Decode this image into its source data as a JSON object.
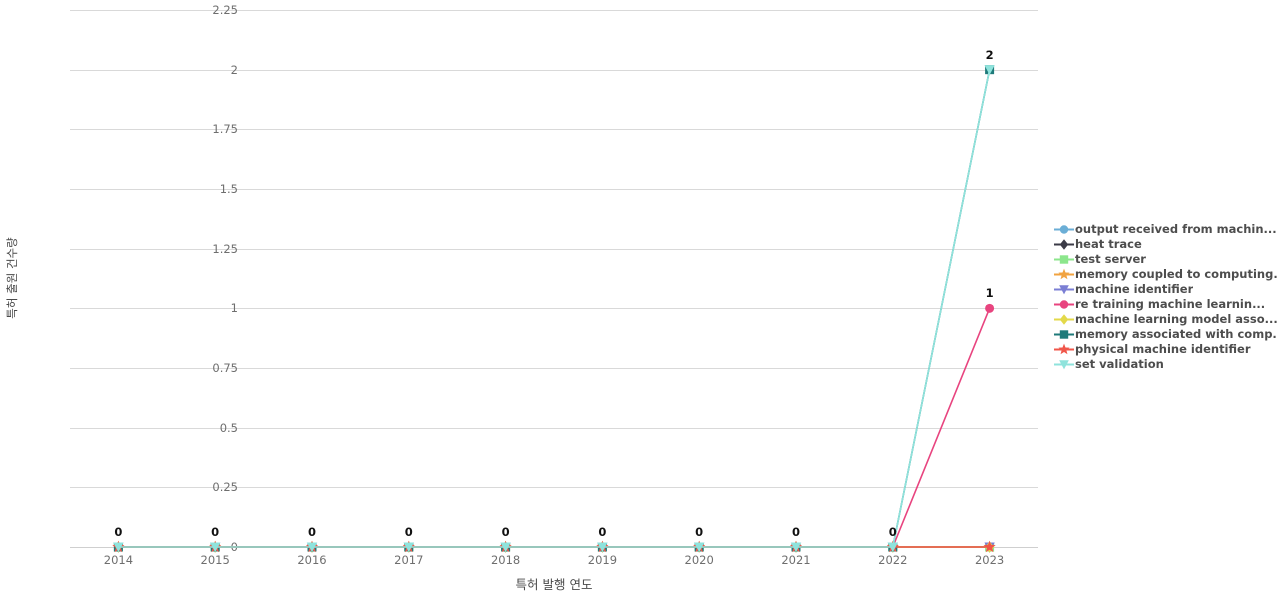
{
  "chart_data": {
    "type": "line",
    "title": "",
    "xlabel": "특허 발행 연도",
    "ylabel": "특허 출원 건수량",
    "categories": [
      "2014",
      "2015",
      "2016",
      "2017",
      "2018",
      "2019",
      "2020",
      "2021",
      "2022",
      "2023"
    ],
    "x_tick_labels": [
      "2014",
      "2015",
      "2016",
      "2017",
      "2018",
      "2019",
      "2020",
      "2021",
      "2022",
      "2023"
    ],
    "y_tick_labels": [
      "0",
      "0.25",
      "0.5",
      "0.75",
      "1",
      "1.25",
      "1.5",
      "1.75",
      "2",
      "2.25"
    ],
    "y_tick_values": [
      0,
      0.25,
      0.5,
      0.75,
      1,
      1.25,
      1.5,
      1.75,
      2,
      2.25
    ],
    "ylim": [
      0,
      2.25
    ],
    "grid": true,
    "legend_position": "right",
    "point_labels": [
      {
        "x": "2014",
        "value": 0,
        "text": "0"
      },
      {
        "x": "2015",
        "value": 0,
        "text": "0"
      },
      {
        "x": "2016",
        "value": 0,
        "text": "0"
      },
      {
        "x": "2017",
        "value": 0,
        "text": "0"
      },
      {
        "x": "2018",
        "value": 0,
        "text": "0"
      },
      {
        "x": "2019",
        "value": 0,
        "text": "0"
      },
      {
        "x": "2020",
        "value": 0,
        "text": "0"
      },
      {
        "x": "2021",
        "value": 0,
        "text": "0"
      },
      {
        "x": "2022",
        "value": 0,
        "text": "0"
      },
      {
        "x": "2023",
        "value": 2,
        "text": "2"
      },
      {
        "x": "2023",
        "value": 1,
        "text": "1"
      }
    ],
    "series": [
      {
        "name": "output received from machin...",
        "color": "#6baed6",
        "marker": "circle",
        "values": [
          0,
          0,
          0,
          0,
          0,
          0,
          0,
          0,
          0,
          0
        ]
      },
      {
        "name": "heat trace",
        "color": "#3b3b47",
        "marker": "diamond",
        "values": [
          0,
          0,
          0,
          0,
          0,
          0,
          0,
          0,
          0,
          0
        ]
      },
      {
        "name": "test server",
        "color": "#8ce68c",
        "marker": "square",
        "values": [
          0,
          0,
          0,
          0,
          0,
          0,
          0,
          0,
          0,
          0
        ]
      },
      {
        "name": "memory coupled to computing...",
        "color": "#f1a340",
        "marker": "star",
        "values": [
          0,
          0,
          0,
          0,
          0,
          0,
          0,
          0,
          0,
          0
        ]
      },
      {
        "name": "machine identifier",
        "color": "#7b7fd4",
        "marker": "triangle-down",
        "values": [
          0,
          0,
          0,
          0,
          0,
          0,
          0,
          0,
          0,
          0
        ]
      },
      {
        "name": "re training machine learnin...",
        "color": "#e8447f",
        "marker": "circle",
        "values": [
          0,
          0,
          0,
          0,
          0,
          0,
          0,
          0,
          0,
          1
        ]
      },
      {
        "name": "machine learning model asso...",
        "color": "#e3d94a",
        "marker": "diamond",
        "values": [
          0,
          0,
          0,
          0,
          0,
          0,
          0,
          0,
          0,
          0
        ]
      },
      {
        "name": "memory associated with comp...",
        "color": "#1f7a7a",
        "marker": "square",
        "values": [
          0,
          0,
          0,
          0,
          0,
          0,
          0,
          0,
          0,
          2
        ]
      },
      {
        "name": "physical machine identifier",
        "color": "#f0564a",
        "marker": "star",
        "values": [
          0,
          0,
          0,
          0,
          0,
          0,
          0,
          0,
          0,
          0
        ]
      },
      {
        "name": "set validation",
        "color": "#8fe3dc",
        "marker": "triangle-down",
        "values": [
          0,
          0,
          0,
          0,
          0,
          0,
          0,
          0,
          0,
          2
        ]
      }
    ]
  }
}
